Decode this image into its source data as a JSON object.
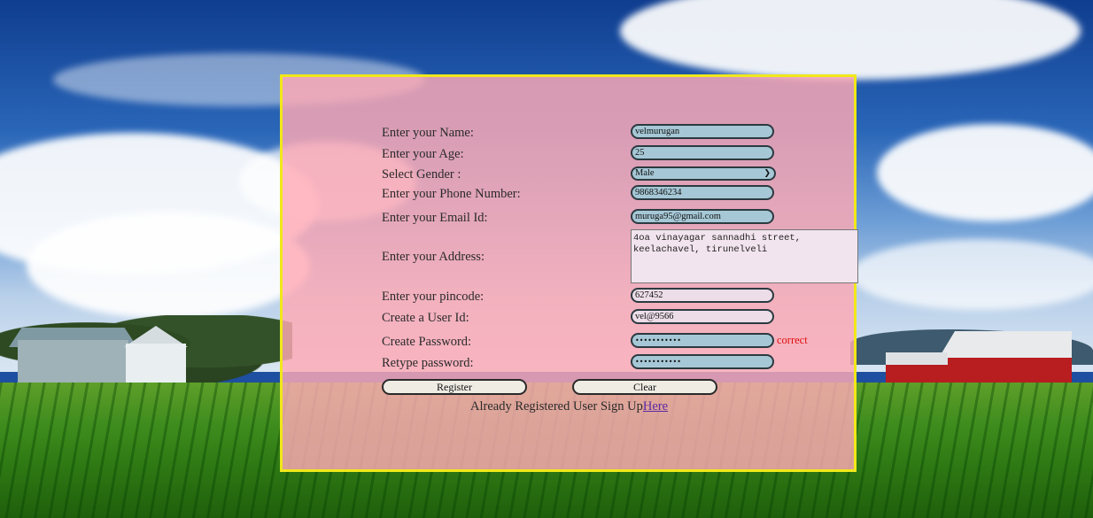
{
  "form": {
    "name": {
      "label": "Enter your Name:",
      "value": "velmurugan"
    },
    "age": {
      "label": "Enter your Age:",
      "value": "25"
    },
    "gender": {
      "label": "Select Gender :",
      "value": "Male"
    },
    "phone": {
      "label": "Enter your Phone Number:",
      "value": "9868346234"
    },
    "email": {
      "label": "Enter your Email Id:",
      "value": "muruga95@gmail.com"
    },
    "address": {
      "label": "Enter your Address:",
      "line1": "4oa vinayagar sannadhi street,",
      "line2": "keelachavel, tirunelveli"
    },
    "pincode": {
      "label": "Enter your pincode:",
      "value": "627452"
    },
    "userid": {
      "label": "Create a User Id:",
      "value": "vel@9566"
    },
    "password": {
      "label": "Create Password:",
      "value": "•••••••••••",
      "status": "correct"
    },
    "retype": {
      "label": "Retype password:",
      "value": "•••••••••••"
    },
    "register_label": "Register",
    "clear_label": "Clear",
    "footer_text": "Already Registered User Sign Up",
    "footer_link": "Here"
  },
  "colors": {
    "panel_bg": "#ffaab4",
    "panel_border": "#f0e81a",
    "status_correct": "#e01010",
    "link": "#5a2aa0"
  },
  "icons": {
    "select_caret": "chevron-down-icon"
  }
}
